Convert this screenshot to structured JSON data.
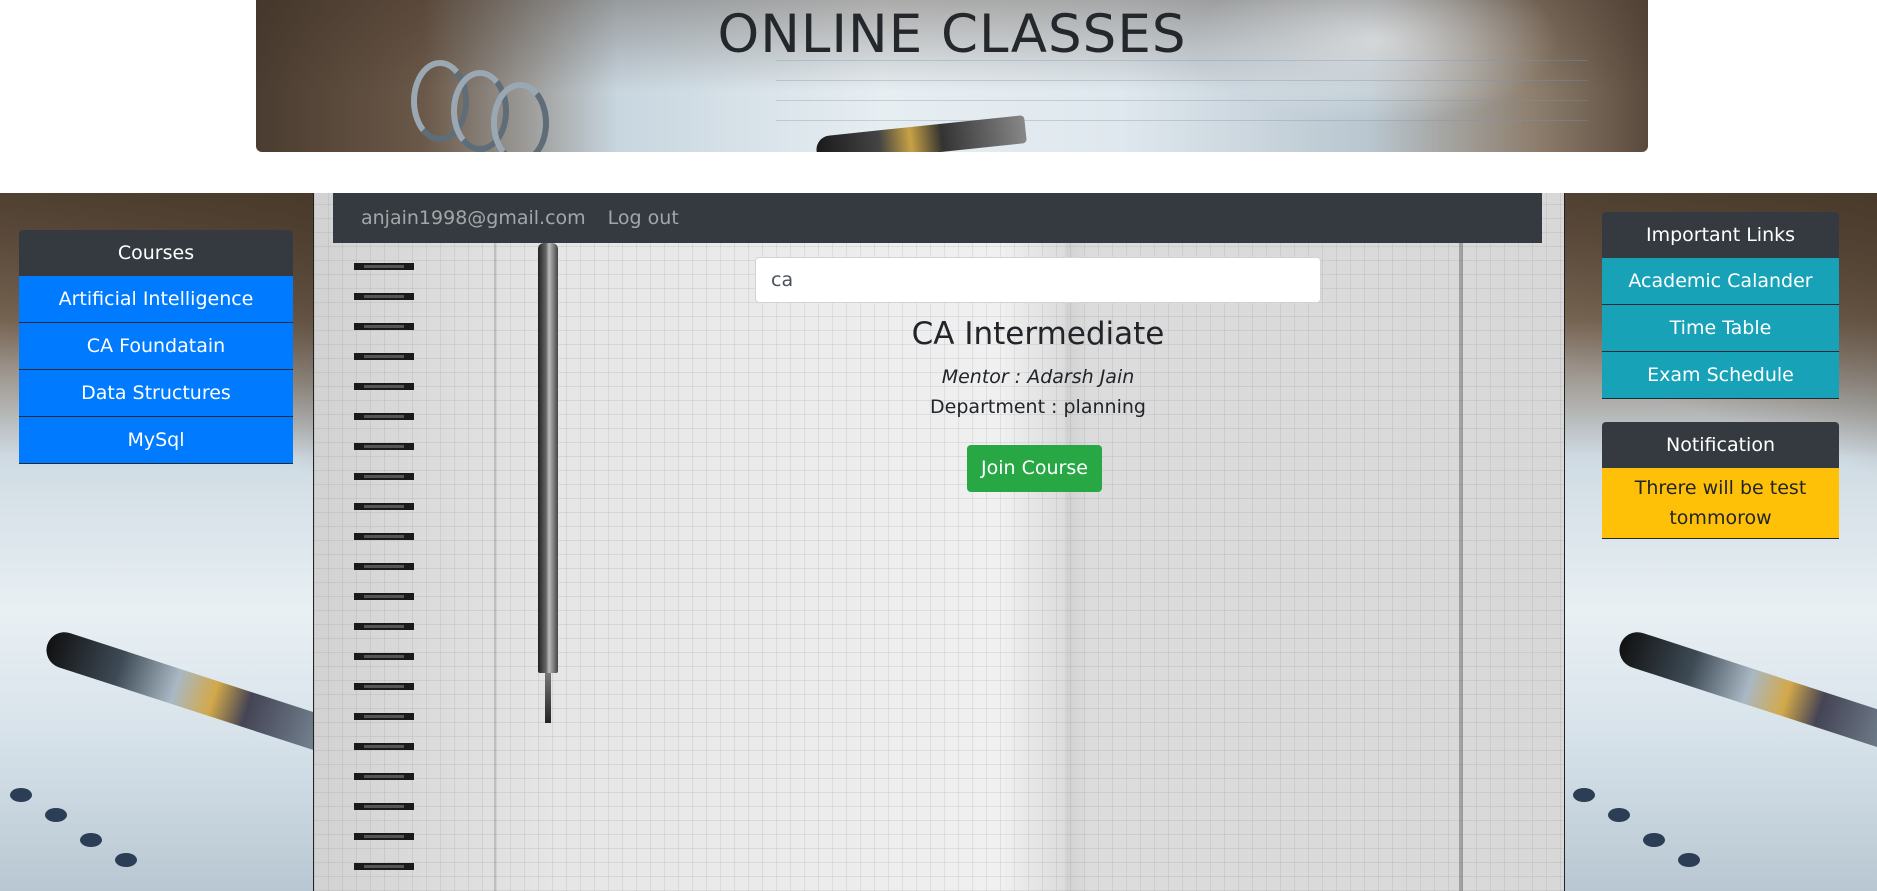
{
  "header": {
    "title": "ONLINE CLASSES"
  },
  "navbar": {
    "user_email": "anjain1998@gmail.com",
    "logout_label": "Log out"
  },
  "search": {
    "value": "ca"
  },
  "course": {
    "title": "CA Intermediate",
    "mentor": "Mentor : Adarsh Jain",
    "department": "Department : planning",
    "join_label": "Join Course"
  },
  "sidebar": {
    "heading": "Courses",
    "items": [
      {
        "label": "Artificial Intelligence"
      },
      {
        "label": "CA Foundatain"
      },
      {
        "label": "Data Structures"
      },
      {
        "label": "MySql"
      }
    ]
  },
  "important_links": {
    "heading": "Important Links",
    "items": [
      {
        "label": "Academic Calander"
      },
      {
        "label": "Time Table"
      },
      {
        "label": "Exam Schedule"
      }
    ]
  },
  "notification": {
    "heading": "Notification",
    "message": "Threre will be test tommorow"
  },
  "colors": {
    "navbar": "#343a40",
    "course_button": "#007bff",
    "link_button": "#17a2b8",
    "join_button": "#28a745",
    "notification": "#ffc107"
  }
}
